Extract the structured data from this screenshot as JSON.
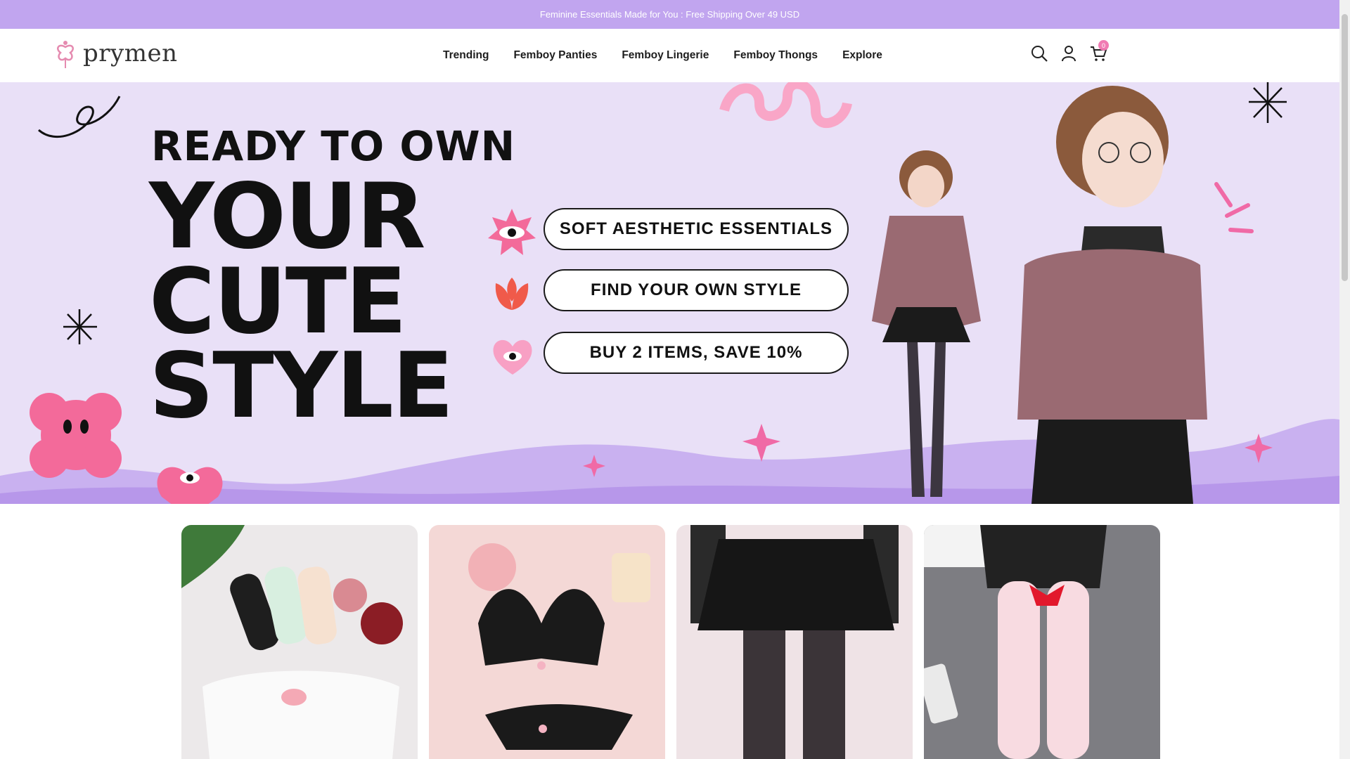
{
  "announcement": "Feminine Essentials Made for You : Free Shipping Over 49 USD",
  "brand": {
    "name": "prymen",
    "accent": "#c1a5ef",
    "pink": "#f07bb3"
  },
  "nav": [
    {
      "label": "Trending"
    },
    {
      "label": "Femboy Panties"
    },
    {
      "label": "Femboy Lingerie"
    },
    {
      "label": "Femboy Thongs"
    },
    {
      "label": "Explore"
    }
  ],
  "header_icons": [
    "search-icon",
    "user-icon",
    "cart-icon"
  ],
  "cart_count": "0",
  "hero": {
    "line1": "READY TO OWN",
    "line2": "YOUR",
    "line3": "CUTE",
    "line4": "STYLE",
    "pills": [
      {
        "label": "SOFT AESTHETIC ESSENTIALS",
        "icon": "eye-star-icon"
      },
      {
        "label": "FIND YOUR OWN STYLE",
        "icon": "tulip-icon"
      },
      {
        "label": "BUY 2 ITEMS, SAVE 10%",
        "icon": "heart-eye-icon"
      }
    ]
  },
  "products": [
    {
      "name": "panties-collection"
    },
    {
      "name": "lingerie-collection"
    },
    {
      "name": "skirt-garter-collection"
    },
    {
      "name": "stockings-collection"
    }
  ]
}
